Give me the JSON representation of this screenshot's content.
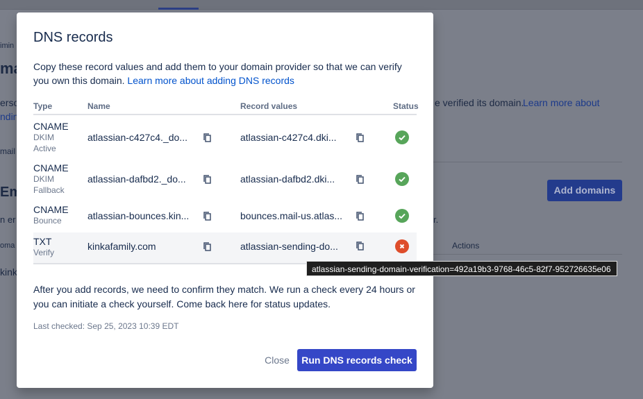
{
  "background": {
    "frag_admin": "imin",
    "frag_heading": "ma",
    "frag_line1": "ersor",
    "frag_line2": "ndin",
    "frag_verified": "e verified its domain.",
    "frag_learn_more": "Learn more about",
    "frag_email_small": "mail",
    "frag_em_heading": "Ema",
    "frag_en_er": "n er",
    "frag_r": "r.",
    "frag_oma": "oma",
    "frag_kinka": "kinka",
    "actions_header": "Actions",
    "add_domains_label": "Add domains"
  },
  "modal": {
    "title": "DNS records",
    "description": "Copy these record values and add them to your domain provider so that we can verify you own this domain.",
    "learn_more_link": "Learn more about adding DNS records",
    "table": {
      "headers": {
        "type": "Type",
        "name": "Name",
        "record_values": "Record values",
        "status": "Status"
      },
      "rows": [
        {
          "type": "CNAME",
          "sub1": "DKIM",
          "sub2": "Active",
          "name": "atlassian-c427c4._do...",
          "value": "atlassian-c427c4.dki...",
          "status": "verified"
        },
        {
          "type": "CNAME",
          "sub1": "DKIM",
          "sub2": "Fallback",
          "name": "atlassian-dafbd2._do...",
          "value": "atlassian-dafbd2.dki...",
          "status": "verified"
        },
        {
          "type": "CNAME",
          "sub1": "Bounce",
          "sub2": "",
          "name": "atlassian-bounces.kin...",
          "value": "bounces.mail-us.atlas...",
          "status": "verified"
        },
        {
          "type": "TXT",
          "sub1": "Verify",
          "sub2": "",
          "name": "kinkafamily.com",
          "value": "atlassian-sending-do...",
          "status": "failed"
        }
      ]
    },
    "after_text": "After you add records, we need to confirm they match. We run a check every 24 hours or you can initiate a check yourself. Come back here for status updates.",
    "last_checked": "Last checked: Sep 25, 2023 10:39 EDT",
    "close_label": "Close",
    "run_check_label": "Run DNS records check"
  },
  "tooltip": {
    "text": "atlassian-sending-domain-verification=492a19b3-9768-46c5-82f7-952726635e06"
  },
  "colors": {
    "primary": "#3547c7",
    "link": "#0052cc",
    "success": "#57a55a",
    "error": "#de4d2b"
  }
}
